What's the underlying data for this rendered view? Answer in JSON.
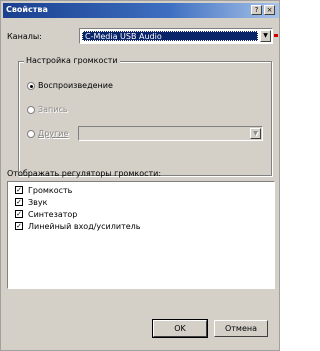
{
  "window": {
    "title": "Свойства",
    "help_label": "?",
    "close_label": "×"
  },
  "device": {
    "label": "Каналы:",
    "value": "C-Media USB Audio"
  },
  "group": {
    "label": "Настройка громкости",
    "options": [
      {
        "label": "Воспроизведение",
        "selected": true,
        "enabled": true
      },
      {
        "label": "Запись",
        "selected": false,
        "enabled": false
      },
      {
        "label": "Другие",
        "selected": false,
        "enabled": false
      }
    ],
    "other_select_value": ""
  },
  "controls": {
    "label": "Отображать регуляторы громкости:",
    "items": [
      {
        "label": "Громкость",
        "checked": true
      },
      {
        "label": "Звук",
        "checked": true
      },
      {
        "label": "Синтезатор",
        "checked": true
      },
      {
        "label": "Линейный вход/усилитель",
        "checked": true
      }
    ]
  },
  "buttons": {
    "ok": "OK",
    "cancel": "Отмена"
  },
  "colors": {
    "titlebar": "#1a3f8f",
    "selection": "#0a246a",
    "face": "#d4d0c8",
    "accent_red": "#cc0000"
  }
}
